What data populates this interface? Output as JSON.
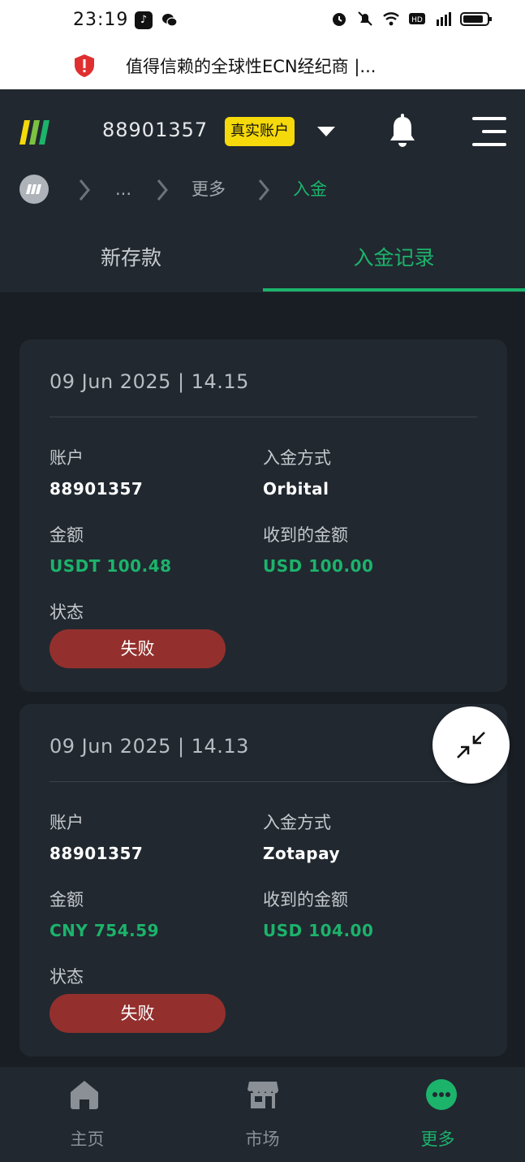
{
  "status_bar": {
    "time": "23:19",
    "icons": [
      "tiktok-icon",
      "wechat-icon",
      "alarm-icon",
      "mute-icon",
      "wifi-icon",
      "hd-icon",
      "signal-4g-icon",
      "battery-icon"
    ]
  },
  "browser": {
    "url_title": "值得信赖的全球性ECN经纪商 |..."
  },
  "header": {
    "account_number": "88901357",
    "account_type_badge": "真实账户"
  },
  "breadcrumb": {
    "ellipsis": "...",
    "more": "更多",
    "current": "入金"
  },
  "tabs": [
    {
      "label": "新存款",
      "active": false
    },
    {
      "label": "入金记录",
      "active": true
    }
  ],
  "labels": {
    "account": "账户",
    "method": "入金方式",
    "amount": "金额",
    "received": "收到的金额",
    "status": "状态"
  },
  "records": [
    {
      "datetime": "09 Jun 2025 | 14.15",
      "account": "88901357",
      "method": "Orbital",
      "amount": "USDT 100.48",
      "received": "USD 100.00",
      "status": "失败"
    },
    {
      "datetime": "09 Jun 2025 | 14.13",
      "account": "88901357",
      "method": "Zotapay",
      "amount": "CNY 754.59",
      "received": "USD 104.00",
      "status": "失败"
    }
  ],
  "bottom_nav": [
    {
      "label": "主页",
      "icon": "home-icon",
      "active": false
    },
    {
      "label": "市场",
      "icon": "store-icon",
      "active": false
    },
    {
      "label": "更多",
      "icon": "more-icon",
      "active": true
    }
  ],
  "colors": {
    "accent_green": "#1cb36b",
    "badge_yellow": "#f5d90a",
    "failed_red": "#93302d",
    "card_bg": "#212830",
    "page_bg": "#191e24"
  }
}
